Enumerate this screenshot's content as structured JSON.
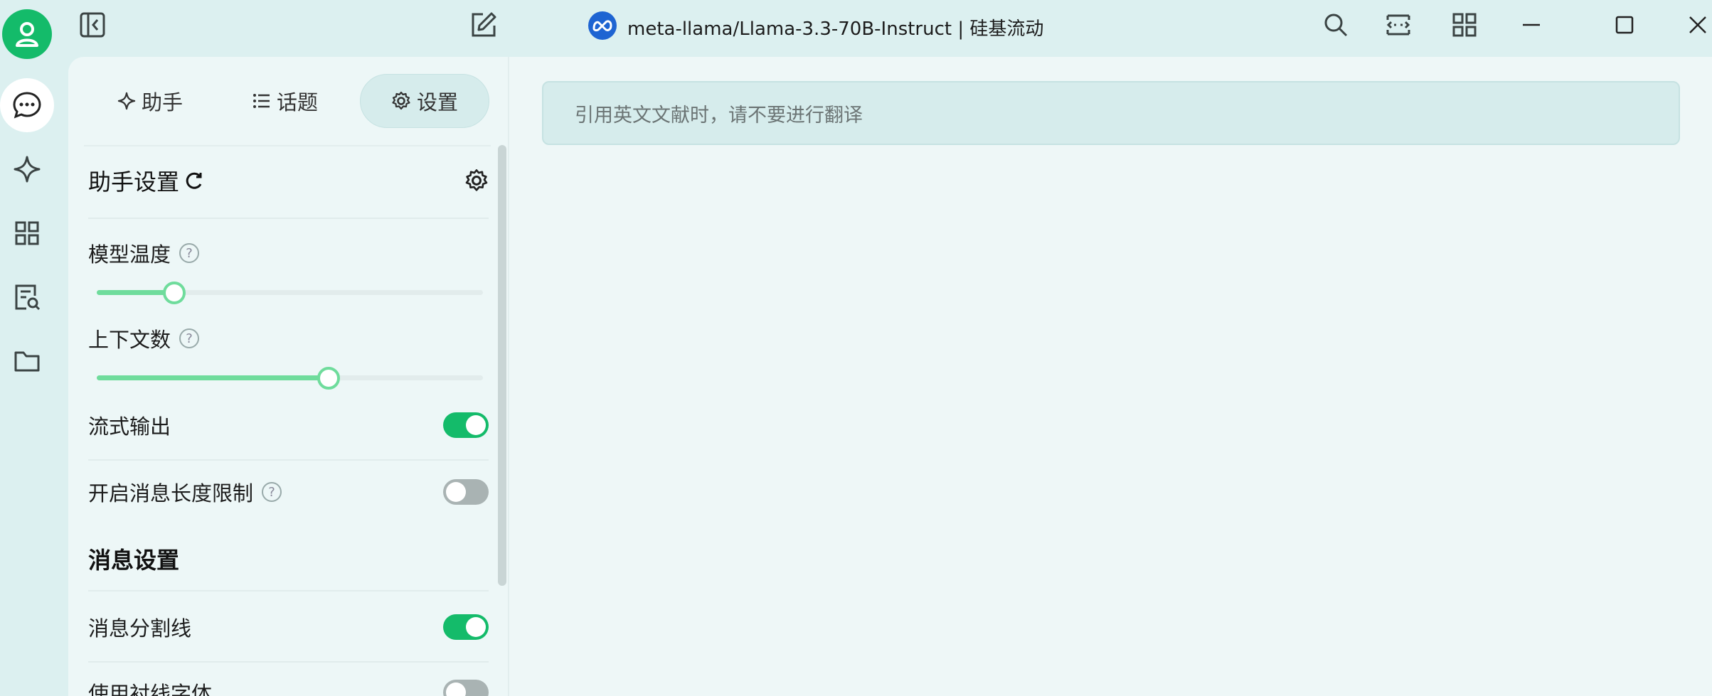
{
  "titlebar": {
    "model_title": "meta-llama/Llama-3.3-70B-Instruct | 硅基流动"
  },
  "rail": {
    "items": [
      "user-icon",
      "chat-icon",
      "sparkle-icon",
      "grid-icon",
      "doc-search-icon",
      "folder-icon"
    ]
  },
  "tabs": [
    {
      "label": "助手",
      "icon": "sparkle-icon"
    },
    {
      "label": "话题",
      "icon": "list-icon"
    },
    {
      "label": "设置",
      "icon": "gear-icon",
      "active": true
    }
  ],
  "settings": {
    "assistant_title": "助手设置",
    "temperature_label": "模型温度",
    "temperature_value": 0.2,
    "context_label": "上下文数",
    "context_value": 0.6,
    "stream_label": "流式输出",
    "stream_on": true,
    "length_limit_label": "开启消息长度限制",
    "length_limit_on": false,
    "message_section": "消息设置",
    "divider_label": "消息分割线",
    "divider_on": true,
    "serif_label": "使用衬线字体",
    "serif_on": false
  },
  "main": {
    "prompt_text": "引用英文文献时，请不要进行翻译"
  },
  "colors": {
    "accent": "#14bb6a",
    "slider": "#6fdc9c",
    "background": "#dcf0f0",
    "panel": "#edf7f7"
  }
}
